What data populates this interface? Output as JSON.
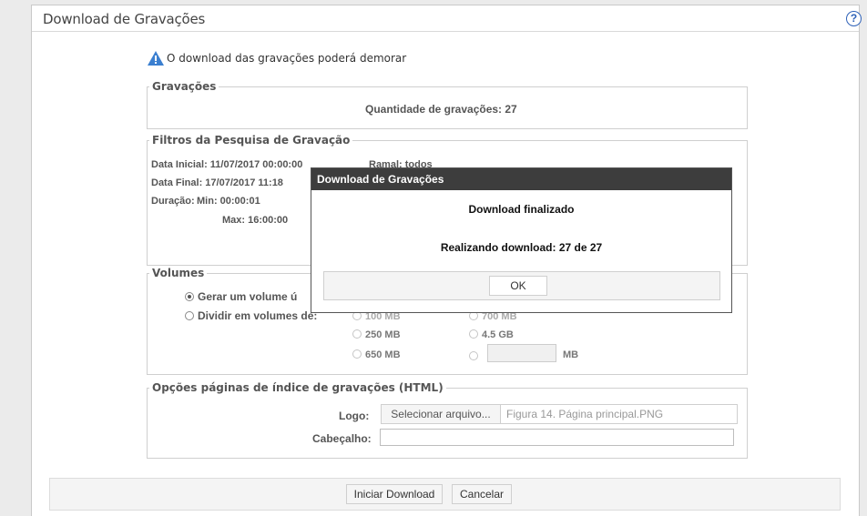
{
  "header": {
    "title": "Download de Gravações",
    "help_symbol": "?"
  },
  "warning": {
    "text": "O download das gravações poderá demorar"
  },
  "recordings": {
    "legend": "Gravações",
    "count_text": "Quantidade de gravações: 27"
  },
  "filters": {
    "legend": "Filtros da Pesquisa de Gravação",
    "start_date": "Data Inicial: 11/07/2017 00:00:00",
    "extension": "Ramal: todos",
    "end_date": "Data Final: 17/07/2017 11:18",
    "duration_label": "Duração:",
    "duration_min": "Min: 00:00:01",
    "duration_max": "Max: 16:00:00"
  },
  "volumes": {
    "legend": "Volumes",
    "single_volume": "Gerar um volume ú",
    "split_volumes": "Dividir em volumes de:",
    "sizes": [
      "100 MB",
      "700 MB",
      "250 MB",
      "4.5 GB",
      "650 MB"
    ],
    "custom_unit": "MB",
    "selected": "single"
  },
  "index_options": {
    "legend": "Opções páginas de índice de gravações (HTML)",
    "logo_label": "Logo:",
    "select_file_button": "Selecionar arquivo...",
    "file_name": "Figura 14. Página principal.PNG",
    "header_label": "Cabeçalho:",
    "header_value": ""
  },
  "footer": {
    "start_button": "Iniciar Download",
    "cancel_button": "Cancelar"
  },
  "modal": {
    "title": "Download de Gravações",
    "status": "Download finalizado",
    "progress": "Realizando download: 27 de 27",
    "ok_button": "OK"
  }
}
